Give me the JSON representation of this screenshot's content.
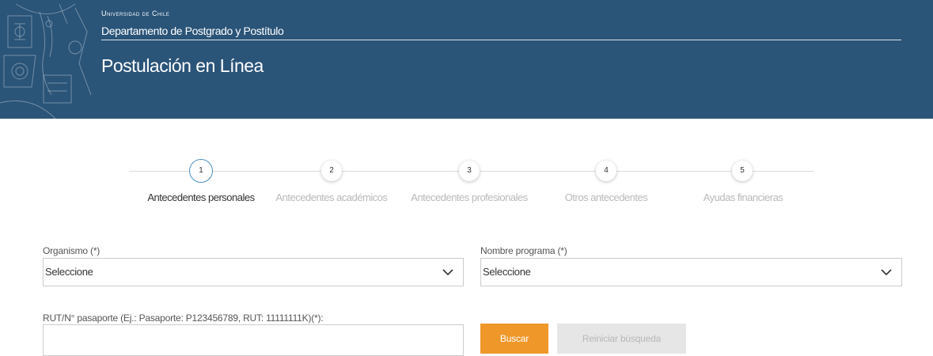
{
  "header": {
    "university": "Universidad de Chile",
    "department": "Departamento de Postgrado y Postítulo",
    "title": "Postulación en Línea"
  },
  "steps": [
    {
      "number": "1",
      "label": "Antecedentes personales",
      "active": true
    },
    {
      "number": "2",
      "label": "Antecedentes académicos",
      "active": false
    },
    {
      "number": "3",
      "label": "Antecedentes profesionales",
      "active": false
    },
    {
      "number": "4",
      "label": "Otros antecedentes",
      "active": false
    },
    {
      "number": "5",
      "label": "Ayudas financieras",
      "active": false
    }
  ],
  "form": {
    "organismo": {
      "label": "Organismo (*)",
      "value": "Seleccione"
    },
    "programa": {
      "label": "Nombre programa (*)",
      "value": "Seleccione"
    },
    "rut": {
      "label": "RUT/N° pasaporte (Ej.: Pasaporte: P123456789, RUT: 11111111K)(*):",
      "value": ""
    },
    "search_button": "Buscar",
    "reset_button": "Reiniciar búsqueda"
  },
  "colors": {
    "header_bg": "#2a5478",
    "accent": "#f0972a",
    "step_active_border": "#4a90c2"
  },
  "icons": {
    "emblem": "university-emblem-icon",
    "dropdown": "chevron-down-icon"
  }
}
